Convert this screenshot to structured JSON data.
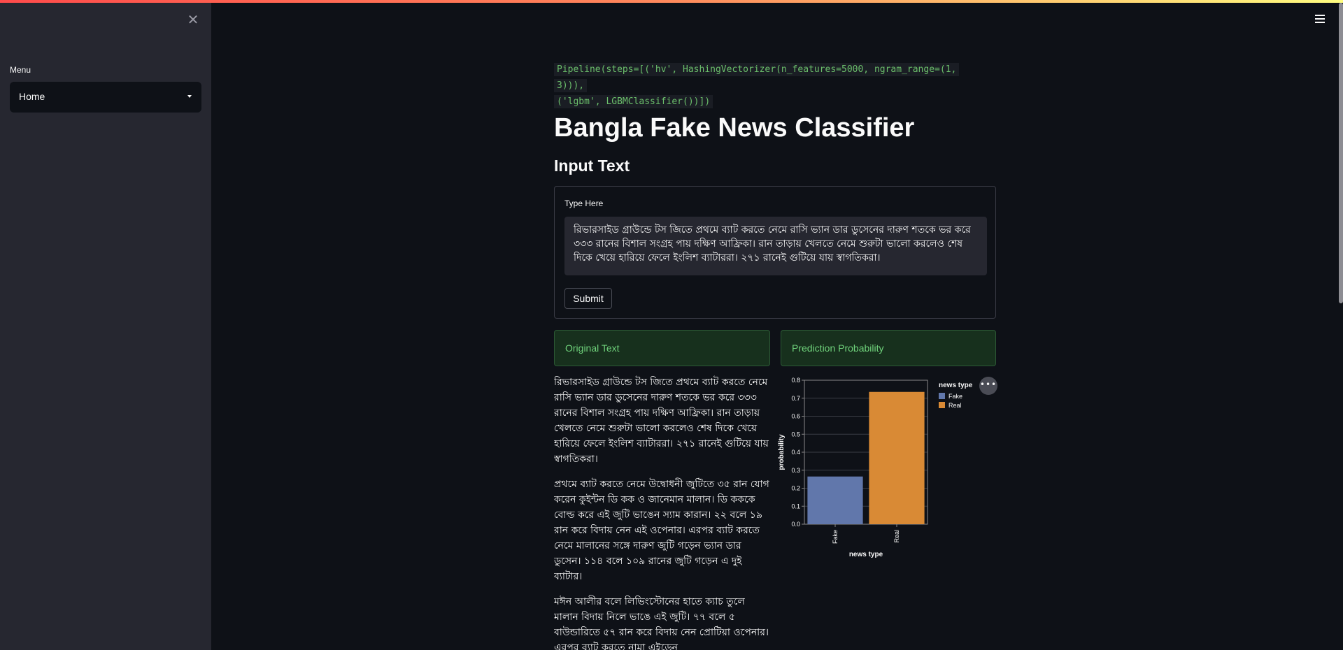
{
  "sidebar": {
    "close_icon": "✕",
    "menu_label": "Menu",
    "selected": "Home"
  },
  "header": {
    "menu_icon": "hamburger-icon"
  },
  "main": {
    "pipeline_code": [
      "Pipeline(steps=[('hv', HashingVectorizer(n_features=5000, ngram_range=(1, 3))),",
      "('lgbm', LGBMClassifier())])"
    ],
    "title": "Bangla Fake News Classifier",
    "subtitle": "Input Text",
    "form": {
      "label": "Type Here",
      "value": "রিভারসাইড গ্রাউন্ডে টস জিতে প্রথমে ব্যাট করতে নেমে রাসি ভ্যান ডার ডুসেনের দারুণ শতকে ভর করে ৩৩৩ রানের বিশাল সংগ্রহ পায় দক্ষিণ আফ্রিকা। রান তাড়ায় খেলতে নেমে শুরুটা ভালো করলেও শেষ দিকে খেয়ে হারিয়ে ফেলে ইংলিশ ব্যাটাররা। ২৭১ রানেই গুটিয়ে যায় স্বাগতিকরা।",
      "submit_label": "Submit"
    },
    "original_text_header": "Original Text",
    "prediction_header": "Prediction Probability",
    "original_paragraphs": [
      "রিভারসাইড গ্রাউন্ডে টস জিতে প্রথমে ব্যাট করতে নেমে রাসি ভ্যান ডার ডুসেনের দারুণ শতকে ভর করে ৩৩৩ রানের বিশাল সংগ্রহ পায় দক্ষিণ আফ্রিকা। রান তাড়ায় খেলতে নেমে শুরুটা ভালো করলেও শেষ দিকে খেয়ে হারিয়ে ফেলে ইংলিশ ব্যাটাররা। ২৭১ রানেই গুটিয়ে যায় স্বাগতিকরা।",
      "প্রথমে ব্যাট করতে নেমে উদ্বোধনী জুটিতে ৩৫ রান যোগ করেন কুইন্টন ডি কক ও জানেমান মালান। ডি কককে বোল্ড করে এই জুটি ভাঙেন স্যাম কারান। ২২ বলে ১৯ রান করে বিদায় নেন এই ওপেনার। এরপর ব্যাট করতে নেমে মালানের সঙ্গে দারুণ জুটি গড়েন ভ্যান ডার ডুসেন। ১১৪ বলে ১০৯ রানের জুটি গড়েন এ দুই ব্যাটার।",
      "মঈন আলীর বলে লিভিংস্টোনের হাতে ক্যাচ তুলে মালান বিদায় নিলে ভাঙে এই জুটি। ৭৭ বলে ৫ বাউন্ডারিতে ৫৭ রান করে বিদায় নেন প্রোটিয়া ওপেনার। এরপর ব্যাট করতে নামা এইডেন"
    ]
  },
  "chart_data": {
    "type": "bar",
    "categories": [
      "Fake",
      "Real"
    ],
    "values": [
      0.265,
      0.735
    ],
    "colors": [
      "#6177ab",
      "#d98a35"
    ],
    "xlabel": "news type",
    "ylabel": "probability",
    "ylim": [
      0,
      0.8
    ],
    "yticks": [
      "0.0",
      "0.1",
      "0.2",
      "0.3",
      "0.4",
      "0.5",
      "0.6",
      "0.7",
      "0.8"
    ],
    "legend_title": "news type",
    "legend": [
      "Fake",
      "Real"
    ],
    "legend_placement": "right",
    "grid": true
  }
}
